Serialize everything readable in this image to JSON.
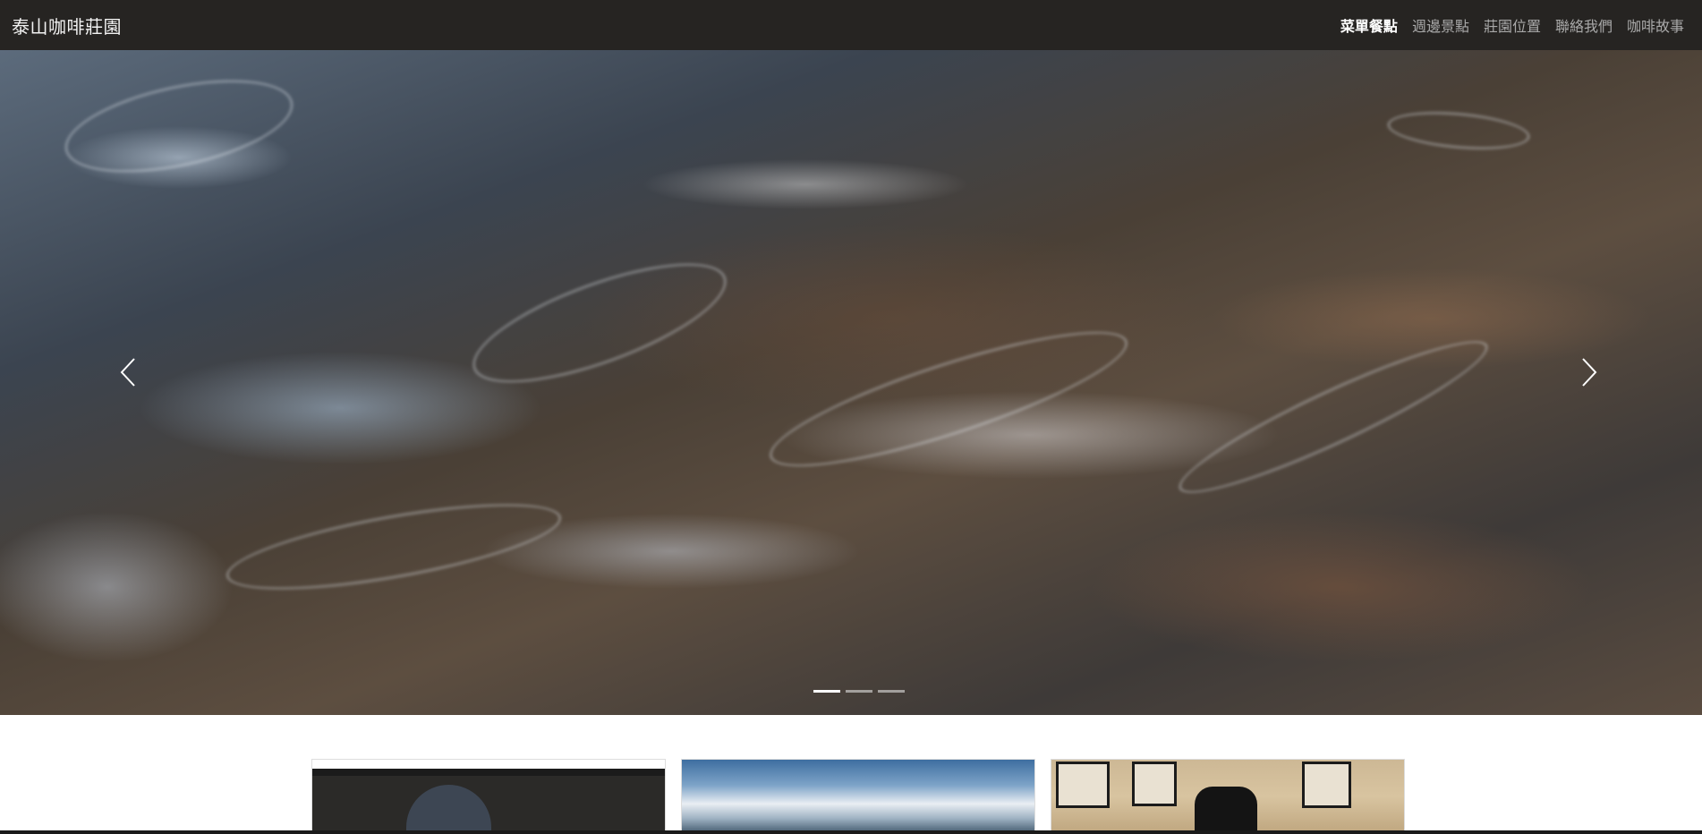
{
  "brand": "泰山咖啡莊園",
  "nav": {
    "items": [
      {
        "label": "菜單餐點",
        "active": true
      },
      {
        "label": "週邊景點",
        "active": false
      },
      {
        "label": "莊園位置",
        "active": false
      },
      {
        "label": "聯絡我們",
        "active": false
      },
      {
        "label": "咖啡故事",
        "active": false
      }
    ]
  },
  "carousel": {
    "icons": {
      "prev": "chevron-left-icon",
      "next": "chevron-right-icon"
    },
    "slide_count": 3,
    "active_index": 0
  },
  "cards": {
    "count": 3
  },
  "colors": {
    "navbar_bg": "#262422",
    "nav_active": "#ffffff",
    "nav_inactive": "#a9a9a9"
  }
}
